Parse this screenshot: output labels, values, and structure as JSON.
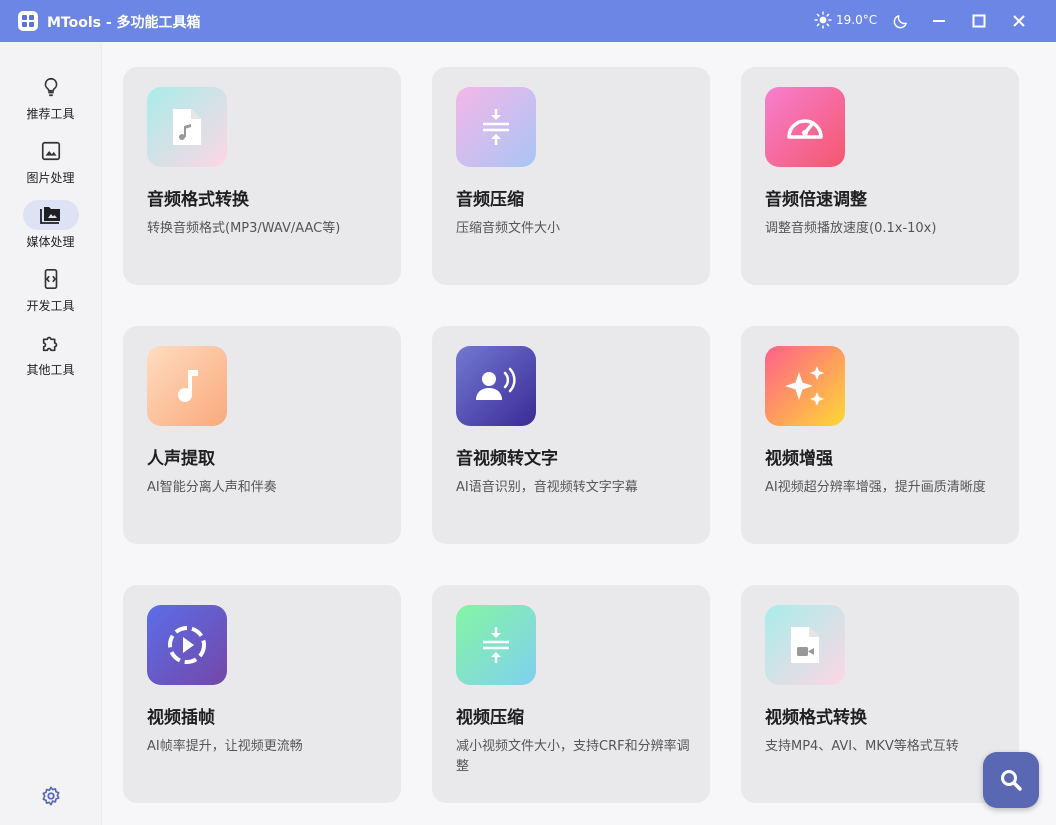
{
  "window": {
    "title": "MTools - 多功能工具箱",
    "temperature": "19.0°C"
  },
  "sidebar": {
    "items": [
      {
        "label": "推荐工具",
        "icon": "lightbulb-icon"
      },
      {
        "label": "图片处理",
        "icon": "image-icon"
      },
      {
        "label": "媒体处理",
        "icon": "media-folder-icon",
        "active": true
      },
      {
        "label": "开发工具",
        "icon": "code-icon"
      },
      {
        "label": "其他工具",
        "icon": "puzzle-icon"
      }
    ]
  },
  "tools": [
    {
      "title": "音频格式转换",
      "desc": "转换音频格式(MP3/WAV/AAC等)",
      "icon": "audio-file-icon"
    },
    {
      "title": "音频压缩",
      "desc": "压缩音频文件大小",
      "icon": "compress-icon"
    },
    {
      "title": "音频倍速调整",
      "desc": "调整音频播放速度(0.1x-10x)",
      "icon": "speedometer-icon"
    },
    {
      "title": "人声提取",
      "desc": "AI智能分离人声和伴奏",
      "icon": "music-note-icon"
    },
    {
      "title": "音视频转文字",
      "desc": "AI语音识别，音视频转文字字幕",
      "icon": "voice-recognition-icon"
    },
    {
      "title": "视频增强",
      "desc": "AI视频超分辨率增强，提升画质清晰度",
      "icon": "sparkle-icon"
    },
    {
      "title": "视频插帧",
      "desc": "AI帧率提升，让视频更流畅",
      "icon": "play-circle-icon"
    },
    {
      "title": "视频压缩",
      "desc": "减小视频文件大小，支持CRF和分辨率调整",
      "icon": "compress-icon"
    },
    {
      "title": "视频格式转换",
      "desc": "支持MP4、AVI、MKV等格式互转",
      "icon": "video-file-icon"
    }
  ],
  "colors": {
    "titlebar": "#6c86e5",
    "accent": "#5a68b3"
  }
}
